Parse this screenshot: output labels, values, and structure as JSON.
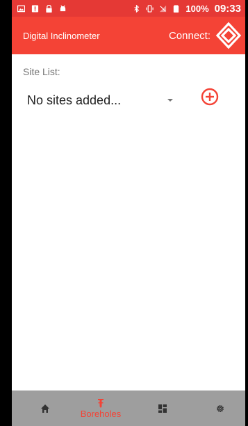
{
  "status_bar": {
    "battery_text": "100%",
    "time": "09:33",
    "left_icons": [
      "image-icon",
      "alert-icon",
      "lock-icon",
      "android-icon"
    ],
    "right_icons": [
      "bluetooth-icon",
      "vibrate-icon",
      "no-signal-icon",
      "battery-icon"
    ]
  },
  "app_bar": {
    "title": "Digital Inclinometer",
    "connect_label": "Connect:",
    "connect_icon": "connect-diamond-icon"
  },
  "site_list": {
    "label": "Site List:",
    "selected": "No sites added...",
    "add_icon": "add-circle-icon"
  },
  "bottom_nav": {
    "items": [
      {
        "name": "home",
        "icon": "home-icon",
        "label": ""
      },
      {
        "name": "boreholes",
        "icon": "borehole-icon",
        "label": "Boreholes",
        "active": true
      },
      {
        "name": "dashboard",
        "icon": "grid-icon",
        "label": ""
      },
      {
        "name": "settings",
        "icon": "gear-icon",
        "label": ""
      }
    ]
  },
  "colors": {
    "status_bar": "#e53935",
    "app_bar": "#f44336",
    "accent": "#f44336",
    "bottom_nav": "#9e9e9e"
  }
}
